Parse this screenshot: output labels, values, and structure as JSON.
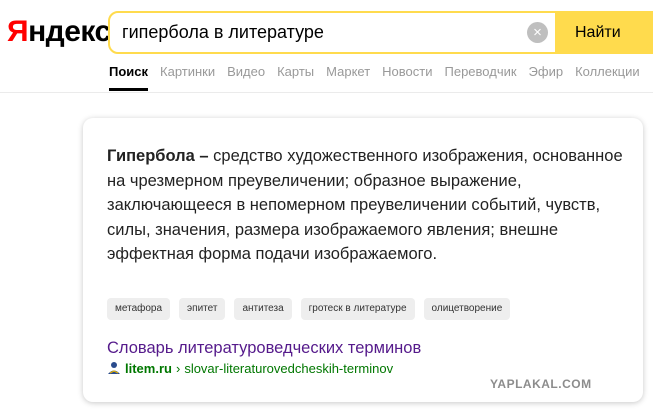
{
  "logo": {
    "first_letter": "Я",
    "rest": "ндекс"
  },
  "search": {
    "query": "гипербола в литературе",
    "clear_icon": "×",
    "button_label": "Найти"
  },
  "tabs": [
    {
      "label": "Поиск",
      "active": true
    },
    {
      "label": "Картинки"
    },
    {
      "label": "Видео"
    },
    {
      "label": "Карты"
    },
    {
      "label": "Маркет"
    },
    {
      "label": "Новости"
    },
    {
      "label": "Переводчик"
    },
    {
      "label": "Эфир"
    },
    {
      "label": "Коллекции"
    }
  ],
  "card": {
    "term": "Гипербола –",
    "definition": " средство художественного изображения, основанное на чрезмерном преувеличении;  образное выражение, заключающееся в непомерном преувеличении событий, чувств, силы, значения, размера изображаемого явления; внешне эффектная форма подачи изображаемого.",
    "chips": [
      "метафора",
      "эпитет",
      "антитеза",
      "гротеск в литературе",
      "олицетворение"
    ],
    "source_title": "Словарь литературоведческих терминов",
    "source_domain": "litem.ru",
    "source_separator": "›",
    "source_path": "slovar-literaturovedcheskih-terminov"
  },
  "watermark": "YAPLAKAL.COM"
}
